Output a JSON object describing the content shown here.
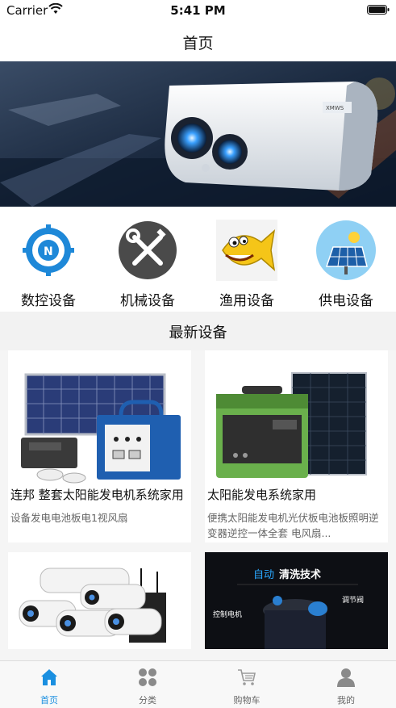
{
  "status_bar": {
    "carrier": "Carrier",
    "time": "5:41 PM"
  },
  "nav": {
    "title": "首页"
  },
  "categories": [
    {
      "label": "数控设备",
      "icon": "cnc-gear-icon"
    },
    {
      "label": "机械设备",
      "icon": "tools-icon"
    },
    {
      "label": "渔用设备",
      "icon": "fish-icon"
    },
    {
      "label": "供电设备",
      "icon": "solar-panel-icon"
    }
  ],
  "section": {
    "title": "最新设备"
  },
  "products": [
    {
      "title": "连邦 整套太阳能发电机系统家用",
      "desc": "设备发电电池板电1视风扇"
    },
    {
      "title": "太阳能发电系统家用",
      "desc": "便携太阳能发电机光伏板电池板照明逆变器逆控一体全套 电风扇..."
    }
  ],
  "cards_bottom": [
    {
      "banner_text_a": "自动",
      "banner_text_b": "清洗技术",
      "label_left": "控制电机",
      "label_right": "调节阀"
    }
  ],
  "tabs": [
    {
      "label": "首页",
      "icon": "home-icon",
      "active": true
    },
    {
      "label": "分类",
      "icon": "category-icon",
      "active": false
    },
    {
      "label": "购物车",
      "icon": "cart-icon",
      "active": false
    },
    {
      "label": "我的",
      "icon": "user-icon",
      "active": false
    }
  ],
  "colors": {
    "accent": "#1a8fe0",
    "section_bg": "#f2f2f2"
  }
}
